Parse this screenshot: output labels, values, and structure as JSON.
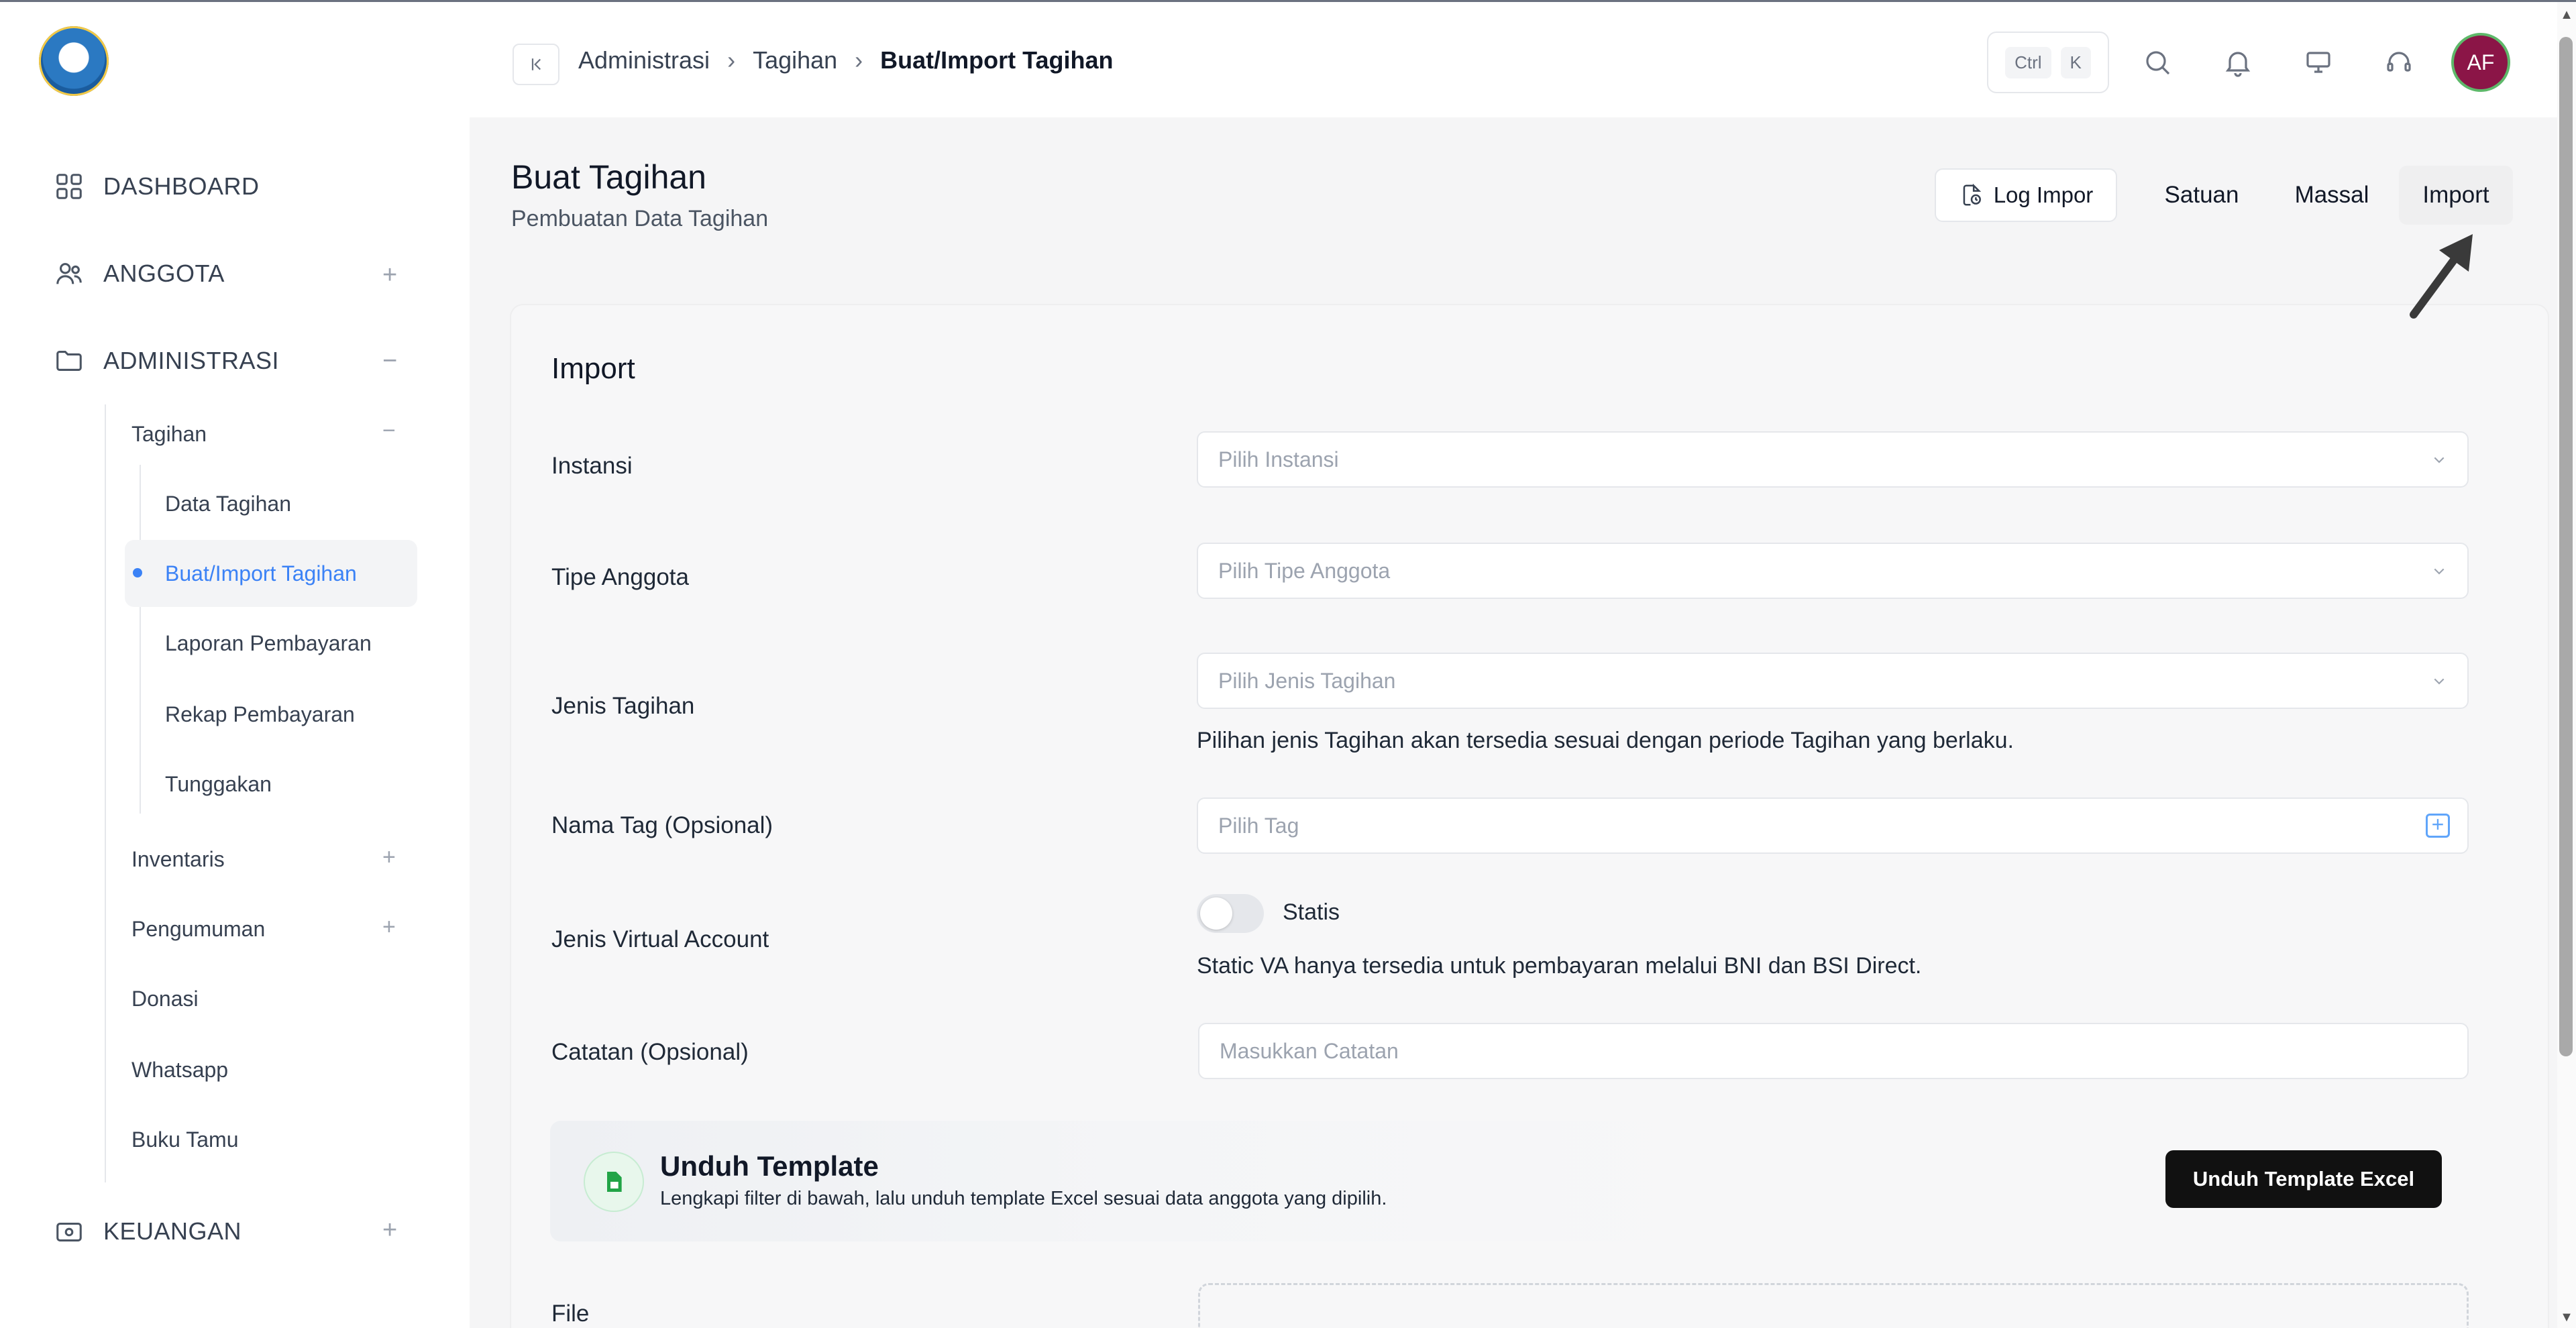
{
  "header": {
    "breadcrumbs": [
      "Administrasi",
      "Tagihan",
      "Buat/Import Tagihan"
    ],
    "shortcut": [
      "Ctrl",
      "K"
    ],
    "avatar_initials": "AF"
  },
  "sidebar": {
    "dashboard": "DASHBOARD",
    "anggota": "ANGGOTA",
    "administrasi": "ADMINISTRASI",
    "keuangan": "KEUANGAN",
    "tagihan": "Tagihan",
    "tagihan_items": [
      "Data Tagihan",
      "Buat/Import Tagihan",
      "Laporan Pembayaran",
      "Rekap Pembayaran",
      "Tunggakan"
    ],
    "other_items": [
      "Inventaris",
      "Pengumuman",
      "Donasi",
      "Whatsapp",
      "Buku Tamu"
    ]
  },
  "page": {
    "title": "Buat Tagihan",
    "subtitle": "Pembuatan Data Tagihan",
    "log_button": "Log Impor",
    "tabs": [
      "Satuan",
      "Massal",
      "Import"
    ]
  },
  "form": {
    "section_title": "Import",
    "instansi_label": "Instansi",
    "instansi_placeholder": "Pilih Instansi",
    "tipe_label": "Tipe Anggota",
    "tipe_placeholder": "Pilih Tipe Anggota",
    "jenis_label": "Jenis Tagihan",
    "jenis_placeholder": "Pilih Jenis Tagihan",
    "jenis_hint": "Pilihan jenis Tagihan akan tersedia sesuai dengan periode Tagihan yang berlaku.",
    "tag_label": "Nama Tag (Opsional)",
    "tag_placeholder": "Pilih Tag",
    "va_label": "Jenis Virtual Account",
    "va_switch_label": "Statis",
    "va_hint": "Static VA hanya tersedia untuk pembayaran melalui BNI dan BSI Direct.",
    "catatan_label": "Catatan (Opsional)",
    "catatan_placeholder": "Masukkan Catatan",
    "file_label": "File"
  },
  "template": {
    "title": "Unduh Template",
    "subtitle": "Lengkapi filter di bawah, lalu unduh template Excel sesuai data anggota yang dipilih.",
    "button": "Unduh Template Excel"
  },
  "colors": {
    "accent": "#3b82f6",
    "avatar_bg": "#8b1547",
    "primary_button": "#111111"
  }
}
